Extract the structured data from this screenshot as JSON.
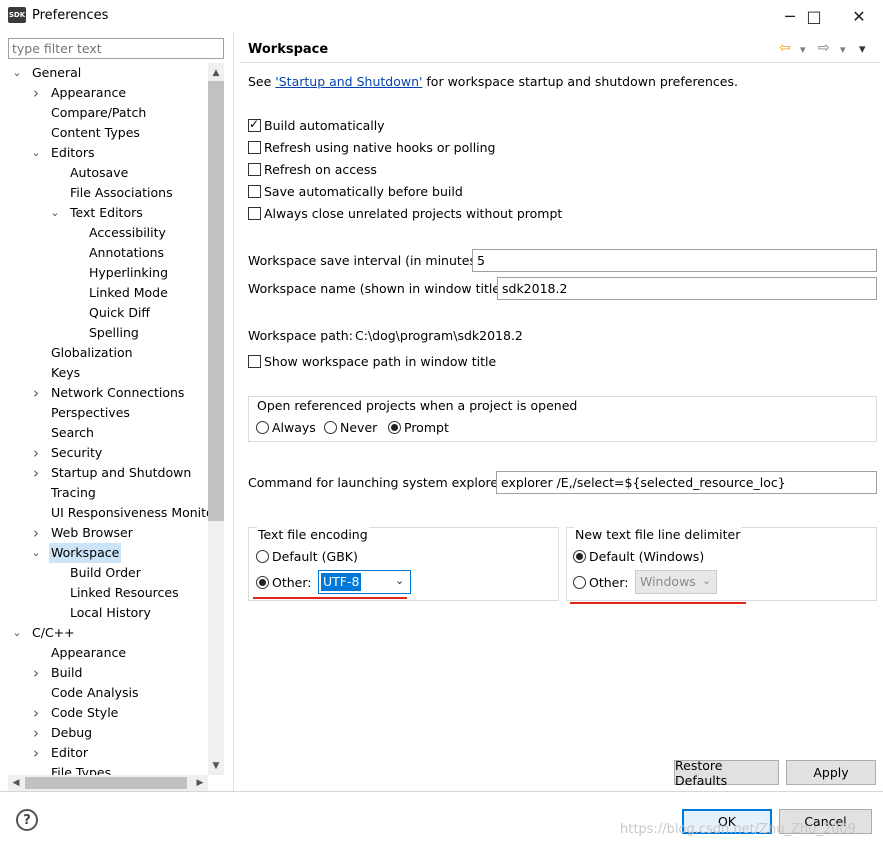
{
  "window": {
    "app_icon_text": "SDK",
    "title": "Preferences",
    "minimize_glyph": "─",
    "maximize_glyph": "□",
    "close_glyph": "✕"
  },
  "filter": {
    "placeholder": "type filter text"
  },
  "tree": {
    "nodes": [
      {
        "label": "General",
        "depth": 0,
        "twisty": "expanded"
      },
      {
        "label": "Appearance",
        "depth": 1,
        "twisty": "collapsed"
      },
      {
        "label": "Compare/Patch",
        "depth": 1,
        "twisty": "none"
      },
      {
        "label": "Content Types",
        "depth": 1,
        "twisty": "none"
      },
      {
        "label": "Editors",
        "depth": 1,
        "twisty": "expanded"
      },
      {
        "label": "Autosave",
        "depth": 2,
        "twisty": "none"
      },
      {
        "label": "File Associations",
        "depth": 2,
        "twisty": "none"
      },
      {
        "label": "Text Editors",
        "depth": 2,
        "twisty": "expanded"
      },
      {
        "label": "Accessibility",
        "depth": 3,
        "twisty": "none"
      },
      {
        "label": "Annotations",
        "depth": 3,
        "twisty": "none"
      },
      {
        "label": "Hyperlinking",
        "depth": 3,
        "twisty": "none"
      },
      {
        "label": "Linked Mode",
        "depth": 3,
        "twisty": "none"
      },
      {
        "label": "Quick Diff",
        "depth": 3,
        "twisty": "none"
      },
      {
        "label": "Spelling",
        "depth": 3,
        "twisty": "none"
      },
      {
        "label": "Globalization",
        "depth": 1,
        "twisty": "none"
      },
      {
        "label": "Keys",
        "depth": 1,
        "twisty": "none"
      },
      {
        "label": "Network Connections",
        "depth": 1,
        "twisty": "collapsed"
      },
      {
        "label": "Perspectives",
        "depth": 1,
        "twisty": "none"
      },
      {
        "label": "Search",
        "depth": 1,
        "twisty": "none"
      },
      {
        "label": "Security",
        "depth": 1,
        "twisty": "collapsed"
      },
      {
        "label": "Startup and Shutdown",
        "depth": 1,
        "twisty": "collapsed"
      },
      {
        "label": "Tracing",
        "depth": 1,
        "twisty": "none"
      },
      {
        "label": "UI Responsiveness Monito",
        "depth": 1,
        "twisty": "none"
      },
      {
        "label": "Web Browser",
        "depth": 1,
        "twisty": "collapsed"
      },
      {
        "label": "Workspace",
        "depth": 1,
        "twisty": "expanded",
        "selected": true
      },
      {
        "label": "Build Order",
        "depth": 2,
        "twisty": "none"
      },
      {
        "label": "Linked Resources",
        "depth": 2,
        "twisty": "none"
      },
      {
        "label": "Local History",
        "depth": 2,
        "twisty": "none"
      },
      {
        "label": "C/C++",
        "depth": 0,
        "twisty": "expanded"
      },
      {
        "label": "Appearance",
        "depth": 1,
        "twisty": "none"
      },
      {
        "label": "Build",
        "depth": 1,
        "twisty": "collapsed"
      },
      {
        "label": "Code Analysis",
        "depth": 1,
        "twisty": "none"
      },
      {
        "label": "Code Style",
        "depth": 1,
        "twisty": "collapsed"
      },
      {
        "label": "Debug",
        "depth": 1,
        "twisty": "collapsed"
      },
      {
        "label": "Editor",
        "depth": 1,
        "twisty": "collapsed"
      },
      {
        "label": "File Types",
        "depth": 1,
        "twisty": "none"
      }
    ],
    "scroll_up_glyph": "▲",
    "scroll_down_glyph": "▼",
    "scroll_left_glyph": "◀",
    "scroll_right_glyph": "▶"
  },
  "page": {
    "title": "Workspace",
    "nav_back_glyph": "⇦",
    "nav_forward_glyph": "⇨",
    "nav_menu_glyph": "▾",
    "nav_back_color": "#e8a317",
    "intro_prefix": "See ",
    "intro_link": "'Startup and Shutdown'",
    "intro_suffix": " for workspace startup and shutdown preferences.",
    "checkboxes": [
      {
        "label": "Build automatically",
        "checked": true
      },
      {
        "label": "Refresh using native hooks or polling",
        "checked": false
      },
      {
        "label": "Refresh on access",
        "checked": false
      },
      {
        "label": "Save automatically before build",
        "checked": false
      },
      {
        "label": "Always close unrelated projects without prompt",
        "checked": false
      }
    ],
    "save_interval_label": "Workspace save interval (in minutes):",
    "save_interval_value": "5",
    "workspace_name_label": "Workspace name (shown in window title):",
    "workspace_name_value": "sdk2018.2",
    "workspace_path_label": "Workspace path:",
    "workspace_path_value": "C:\\dog\\program\\sdk2018.2",
    "show_path_label": "Show workspace path in window title",
    "show_path_checked": false,
    "open_projects": {
      "title": "Open referenced projects when a project is opened",
      "options": [
        "Always",
        "Never",
        "Prompt"
      ],
      "selected": "Prompt"
    },
    "explorer_label": "Command for launching system explorer:",
    "explorer_value": "explorer /E,/select=${selected_resource_loc}",
    "encoding": {
      "title": "Text file encoding",
      "default_label": "Default (GBK)",
      "other_label": "Other:",
      "selected": "Other",
      "other_value": "UTF-8"
    },
    "delimiter": {
      "title": "New text file line delimiter",
      "default_label": "Default (Windows)",
      "other_label": "Other:",
      "selected": "Default",
      "other_value": "Windows"
    },
    "restore_defaults_label": "Restore Defaults",
    "apply_label": "Apply",
    "annotation_color": "#e0251b"
  },
  "footer": {
    "help_glyph": "?",
    "ok_label": "OK",
    "cancel_label": "Cancel",
    "watermark": "https://blog.csdn.net/Zhu_Zhu_2009"
  }
}
